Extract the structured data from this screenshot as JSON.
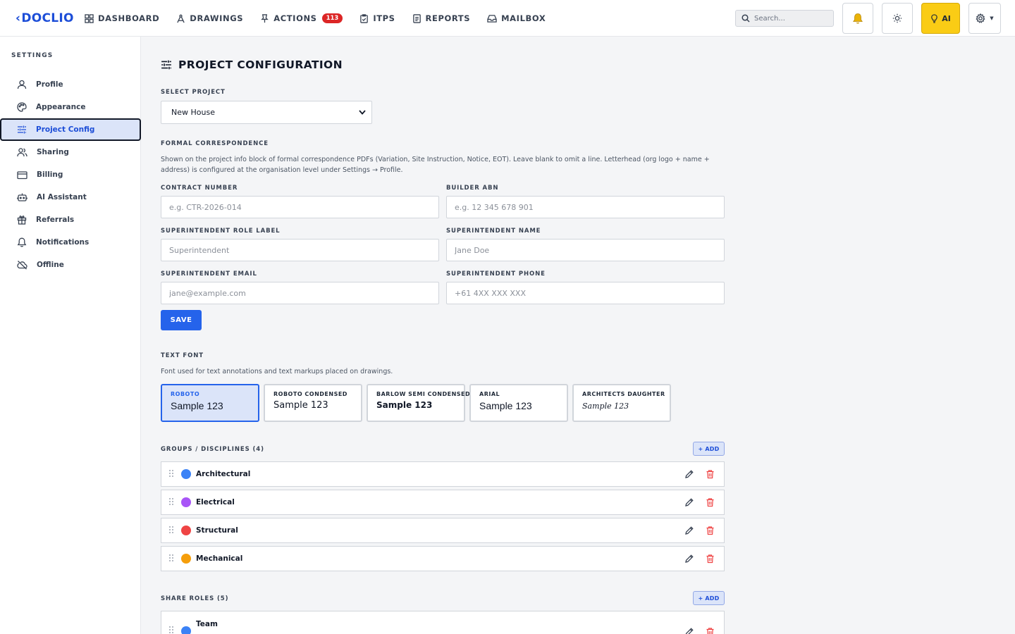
{
  "app": {
    "logo_text": "DOCLIO",
    "logo_chevron": "‹"
  },
  "nav": [
    {
      "label": "DASHBOARD",
      "icon": "grid-icon"
    },
    {
      "label": "DRAWINGS",
      "icon": "compass-icon"
    },
    {
      "label": "ACTIONS",
      "icon": "pin-icon",
      "badge": "113"
    },
    {
      "label": "ITPS",
      "icon": "clipboard-check-icon"
    },
    {
      "label": "REPORTS",
      "icon": "document-icon"
    },
    {
      "label": "MAILBOX",
      "icon": "inbox-icon"
    }
  ],
  "search": {
    "placeholder": "Search..."
  },
  "toolbar": {
    "ai_label": "AI",
    "gear_caret": "▼"
  },
  "sidebar": {
    "title": "SETTINGS",
    "items": [
      {
        "label": "Profile",
        "icon": "user-icon"
      },
      {
        "label": "Appearance",
        "icon": "palette-icon"
      },
      {
        "label": "Project Config",
        "icon": "sliders-icon",
        "active": true
      },
      {
        "label": "Sharing",
        "icon": "users-icon"
      },
      {
        "label": "Billing",
        "icon": "credit-card-icon"
      },
      {
        "label": "AI Assistant",
        "icon": "bot-icon"
      },
      {
        "label": "Referrals",
        "icon": "gift-icon"
      },
      {
        "label": "Notifications",
        "icon": "bell-icon"
      },
      {
        "label": "Offline",
        "icon": "cloud-off-icon"
      }
    ]
  },
  "main": {
    "title": "PROJECT CONFIGURATION",
    "select_project_label": "SELECT PROJECT",
    "selected_project": "New House",
    "formal_label": "FORMAL CORRESPONDENCE",
    "formal_help": "Shown on the project info block of formal correspondence PDFs (Variation, Site Instruction, Notice, EOT). Leave blank to omit a line. Letterhead (org logo + name + address) is configured at the organisation level under Settings → Profile.",
    "fields": {
      "contract_number": {
        "label": "CONTRACT NUMBER",
        "placeholder": "e.g. CTR-2026-014",
        "value": ""
      },
      "builder_abn": {
        "label": "BUILDER ABN",
        "placeholder": "e.g. 12 345 678 901",
        "value": ""
      },
      "super_role": {
        "label": "SUPERINTENDENT ROLE LABEL",
        "placeholder": "Superintendent",
        "value": ""
      },
      "super_name": {
        "label": "SUPERINTENDENT NAME",
        "placeholder": "Jane Doe",
        "value": ""
      },
      "super_email": {
        "label": "SUPERINTENDENT EMAIL",
        "placeholder": "jane@example.com",
        "value": ""
      },
      "super_phone": {
        "label": "SUPERINTENDENT PHONE",
        "placeholder": "+61 4XX XXX XXX",
        "value": ""
      }
    },
    "save_label": "SAVE",
    "text_font_label": "TEXT FONT",
    "text_font_help": "Font used for text annotations and text markups placed on drawings.",
    "fonts": [
      {
        "name": "ROBOTO",
        "sample": "Sample 123",
        "selected": true
      },
      {
        "name": "ROBOTO CONDENSED",
        "sample": "Sample 123"
      },
      {
        "name": "BARLOW SEMI CONDENSED",
        "sample": "Sample 123"
      },
      {
        "name": "ARIAL",
        "sample": "Sample 123"
      },
      {
        "name": "ARCHITECTS DAUGHTER",
        "sample": "Sample 123"
      }
    ],
    "groups_label": "GROUPS / DISCIPLINES (4)",
    "add_label": "+ ADD",
    "groups": [
      {
        "name": "Architectural",
        "color": "#3b82f6"
      },
      {
        "name": "Electrical",
        "color": "#a855f7"
      },
      {
        "name": "Structural",
        "color": "#ef4444"
      },
      {
        "name": "Mechanical",
        "color": "#f59e0b"
      }
    ],
    "share_roles_label": "SHARE ROLES (5)",
    "share_roles": [
      {
        "name": "Team",
        "color": "#3b82f6"
      }
    ]
  },
  "colors": {
    "accent": "#2563eb",
    "danger": "#dc2626",
    "ai_yellow": "#facc15",
    "active_bg": "#dbe4f9"
  }
}
